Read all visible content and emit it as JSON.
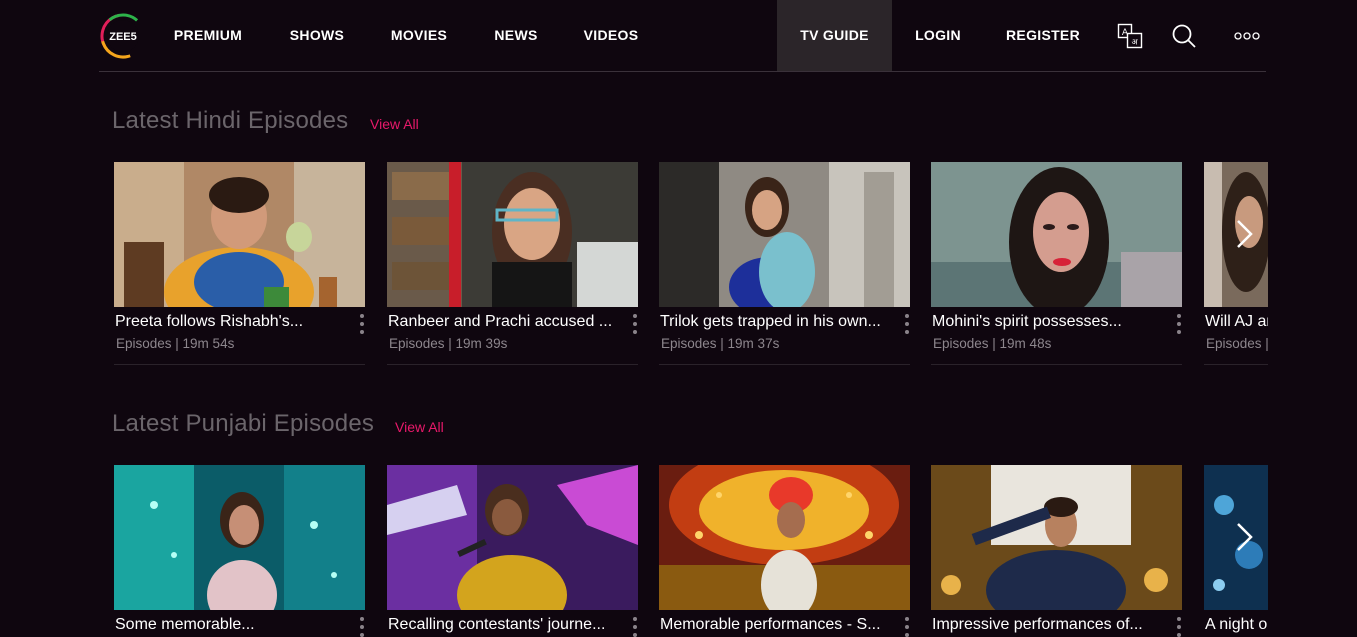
{
  "header": {
    "logo_text": "ZEE5",
    "nav": {
      "premium": "PREMIUM",
      "shows": "SHOWS",
      "movies": "MOVIES",
      "news": "NEWS",
      "videos": "VIDEOS",
      "tv_guide": "TV GUIDE",
      "login": "LOGIN",
      "register": "REGISTER"
    },
    "icons": {
      "language": "language-icon",
      "search": "search-icon",
      "more": "more-icon"
    }
  },
  "sections": [
    {
      "title": "Latest Hindi Episodes",
      "view_all": "View All",
      "cards": [
        {
          "title": "Preeta follows Rishabh's...",
          "meta": "Episodes | 19m 54s"
        },
        {
          "title": "Ranbeer and Prachi accused ...",
          "meta": "Episodes | 19m 39s"
        },
        {
          "title": "Trilok gets trapped in his own...",
          "meta": "Episodes | 19m 37s"
        },
        {
          "title": "Mohini's spirit possesses...",
          "meta": "Episodes | 19m 48s"
        },
        {
          "title": "Will AJ ar",
          "meta": "Episodes |"
        }
      ]
    },
    {
      "title": "Latest Punjabi Episodes",
      "view_all": "View All",
      "cards": [
        {
          "title": "Some memorable..."
        },
        {
          "title": "Recalling contestants' journe..."
        },
        {
          "title": "Memorable performances - S..."
        },
        {
          "title": "Impressive performances of..."
        },
        {
          "title": "A night o"
        }
      ]
    }
  ],
  "colors": {
    "background": "#0f060f",
    "accent": "#e8196a",
    "section_title": "#6b656b",
    "meta": "#8d868d",
    "tv_guide_bg": "#2b2529"
  }
}
